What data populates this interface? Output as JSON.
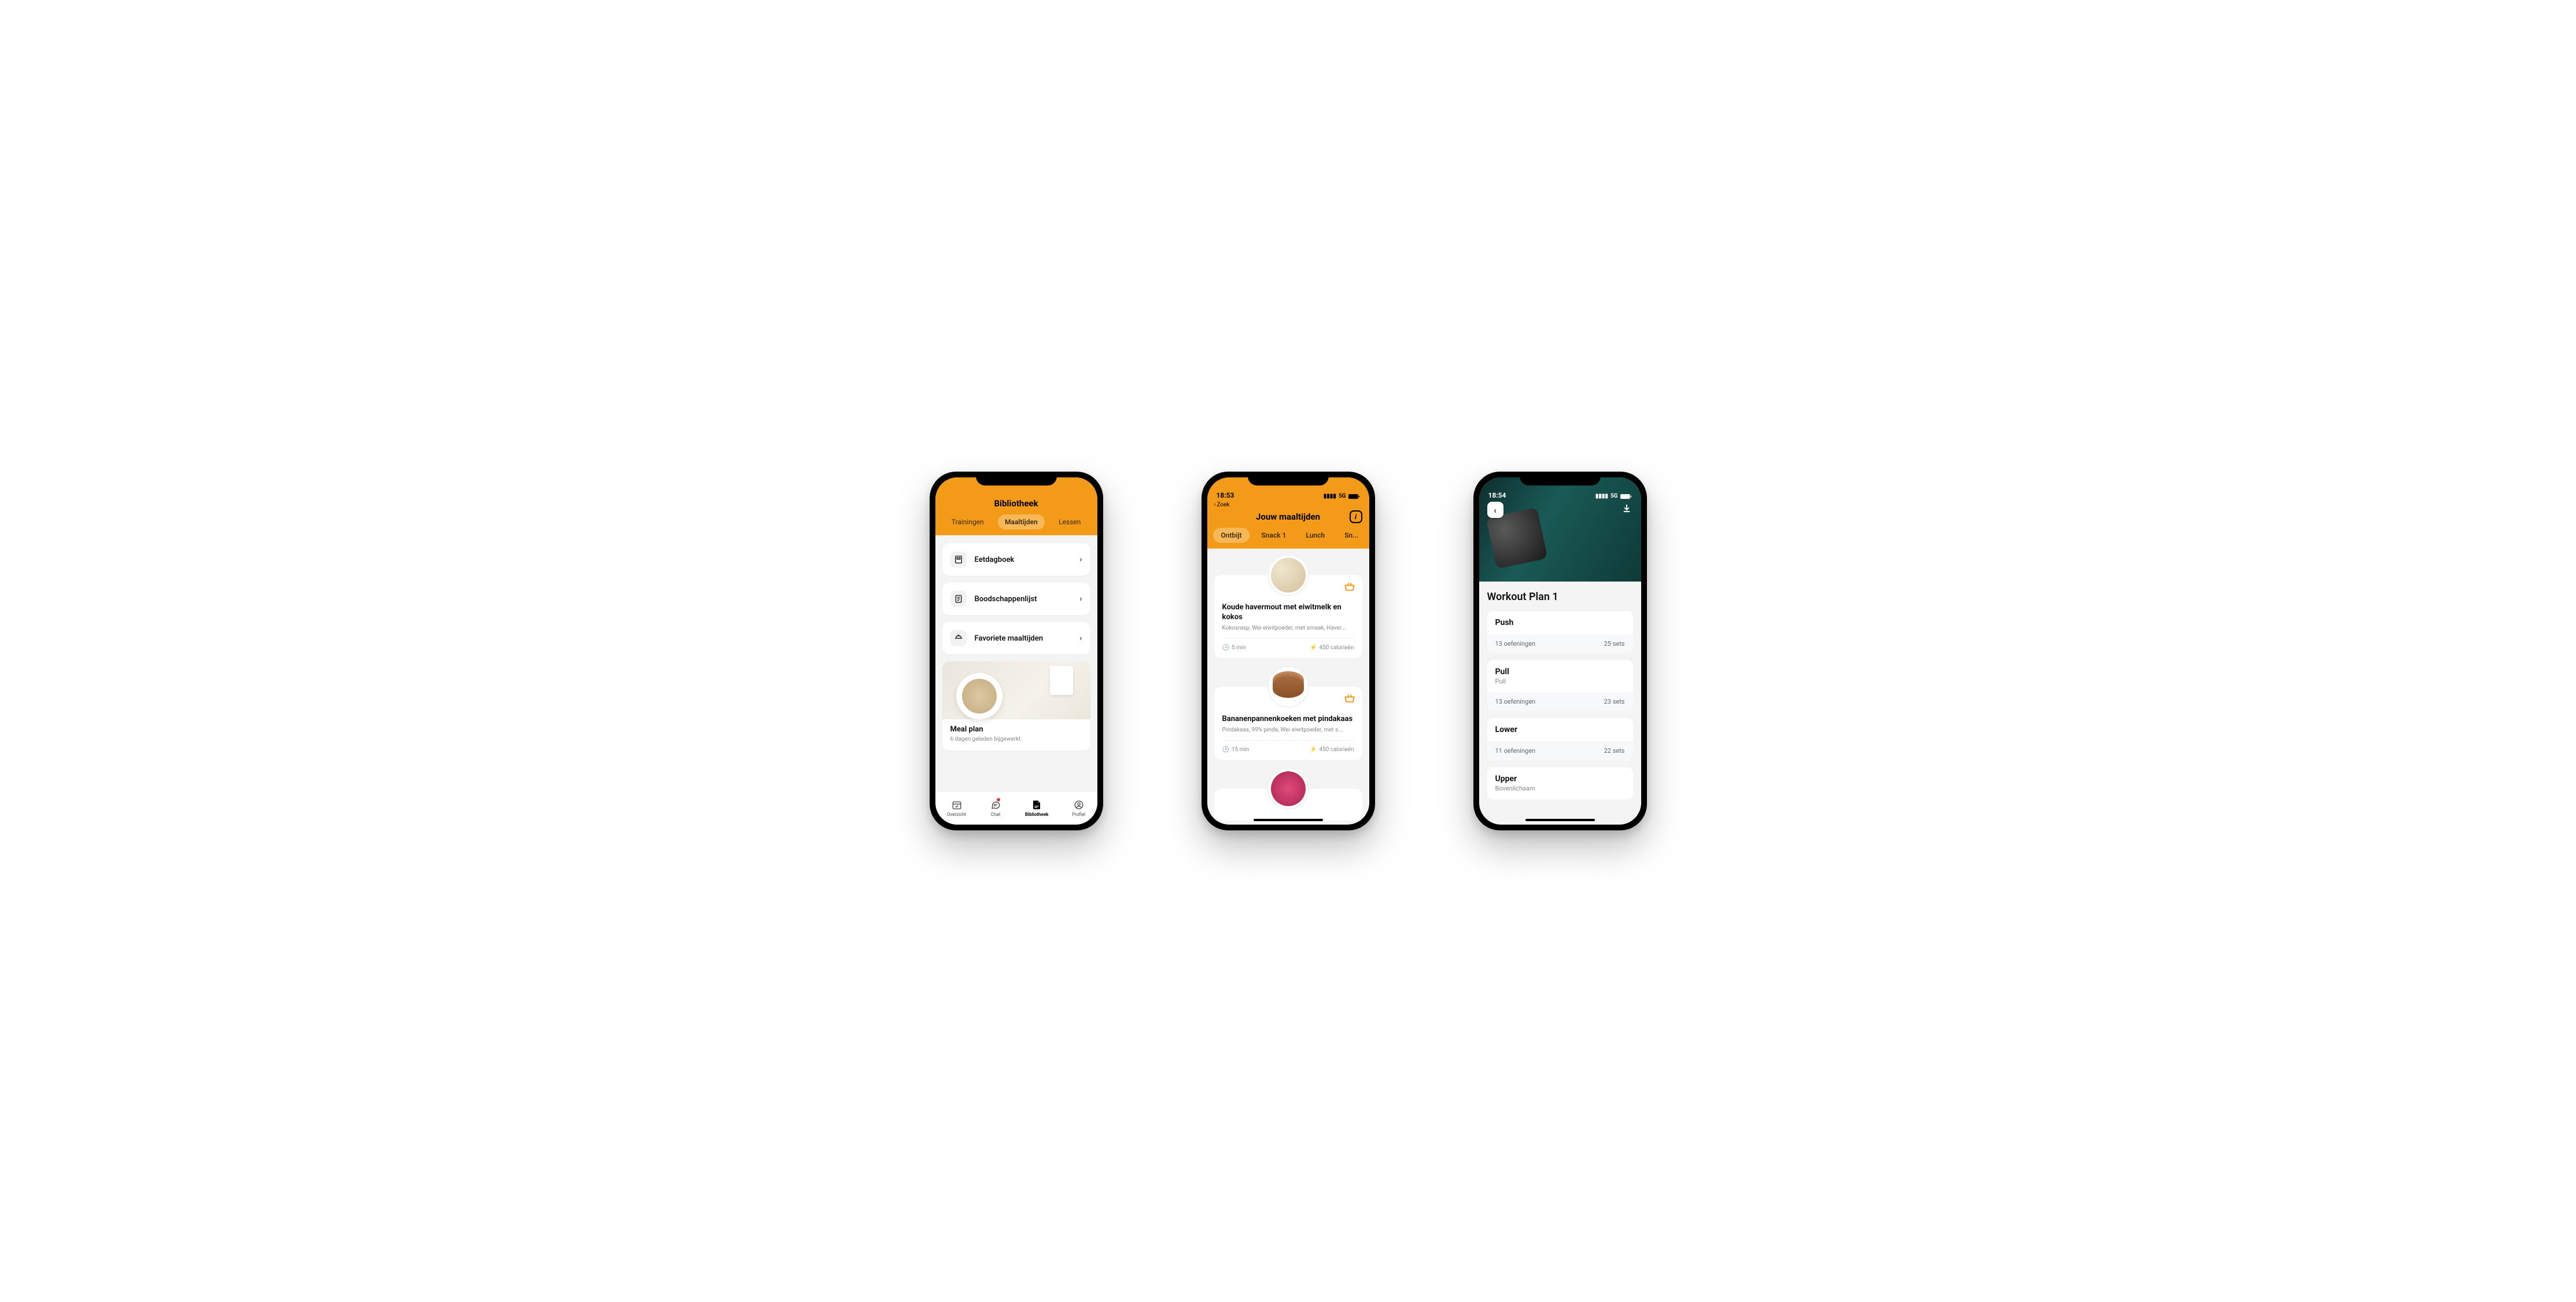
{
  "phone1": {
    "header_title": "Bibliotheek",
    "tabs": {
      "trainings": "Trainingen",
      "meals": "Maaltijden",
      "lessons": "Lessen"
    },
    "rows": {
      "food_diary": "Eetdagboek",
      "grocery_list": "Boodschappenlijst",
      "favorite_meals": "Favoriete maaltijden"
    },
    "meal_card": {
      "title": "Meal plan",
      "subtitle": "6 dagen geleden bijgewerkt"
    },
    "tabbar": {
      "overview": "Overzicht",
      "chat": "Chat",
      "library": "Bibliotheek",
      "profile": "Profiel"
    }
  },
  "phone2": {
    "status_time": "18:53",
    "status_net": "5G",
    "back_label": "Zoek",
    "title": "Jouw maaltijden",
    "pills": {
      "breakfast": "Ontbijt",
      "snack1": "Snack 1",
      "lunch": "Lunch",
      "snack2": "Sn..."
    },
    "meals": [
      {
        "title": "Koude havermout met eiwitmelk en kokos",
        "subtitle": "Kokosrasp, Wei eiwitpoeder, met smaak, Haver...",
        "time": "5 min",
        "calories": "450 calorieën"
      },
      {
        "title": "Bananenpannenkoeken met pindakaas",
        "subtitle": "Pindakaas, 99% pinda, Wei eiwitpoeder, met s...",
        "time": "15 min",
        "calories": "450 calorieën"
      }
    ]
  },
  "phone3": {
    "status_time": "18:54",
    "status_net": "5G",
    "title": "Workout Plan 1",
    "cards": [
      {
        "name": "Push",
        "sub": "",
        "exercises": "13 oefeningen",
        "sets": "25 sets"
      },
      {
        "name": "Pull",
        "sub": "Pull",
        "exercises": "13 oefeningen",
        "sets": "23 sets"
      },
      {
        "name": "Lower",
        "sub": "",
        "exercises": "11 oefeningen",
        "sets": "22 sets"
      },
      {
        "name": "Upper",
        "sub": "Bovenlichaam",
        "exercises": "",
        "sets": ""
      }
    ]
  }
}
